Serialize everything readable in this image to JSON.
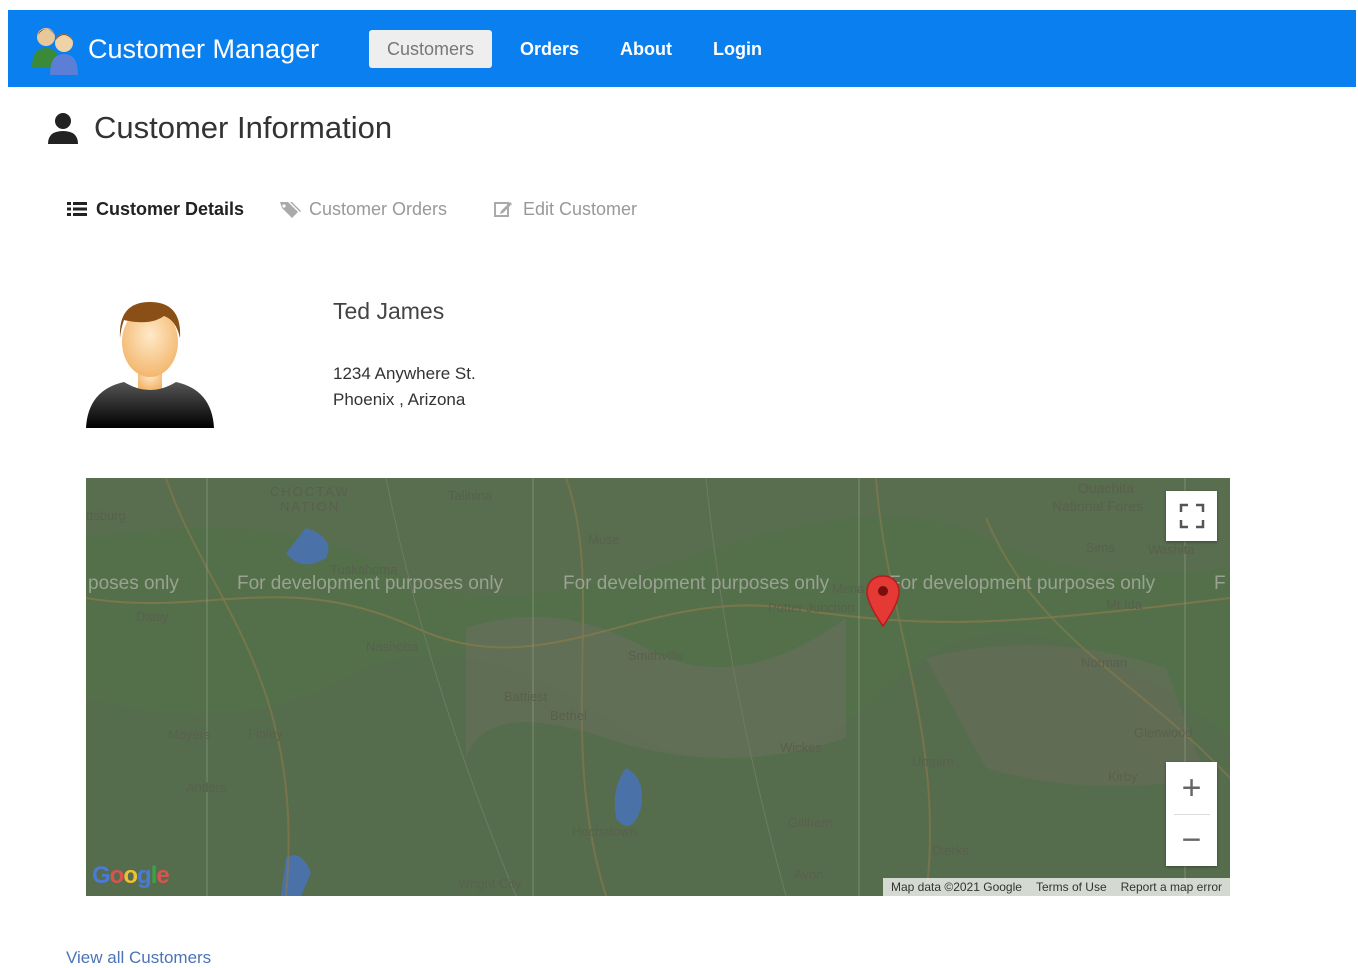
{
  "navbar": {
    "brand": "Customer Manager",
    "items": [
      {
        "label": "Customers",
        "active": true
      },
      {
        "label": "Orders",
        "active": false
      },
      {
        "label": "About",
        "active": false
      },
      {
        "label": "Login",
        "active": false
      }
    ],
    "color": "#0a7ff0"
  },
  "page": {
    "title": "Customer Information"
  },
  "tabs": [
    {
      "label": "Customer Details",
      "icon": "list-icon",
      "active": true
    },
    {
      "label": "Customer Orders",
      "icon": "tags-icon",
      "active": false
    },
    {
      "label": "Edit Customer",
      "icon": "edit-icon",
      "active": false
    }
  ],
  "customer": {
    "name": "Ted James",
    "address_line1": "1234 Anywhere St.",
    "address_line2": "Phoenix , Arizona"
  },
  "map": {
    "dev_text": "For development purposes only",
    "dev_text_partial_left": "poses only",
    "dev_text_partial_right": "F",
    "zoom_in": "+",
    "zoom_out": "−",
    "attribution": {
      "map_data": "Map data ©2021 Google",
      "terms": "Terms of Use",
      "report": "Report a map error"
    },
    "google_logo": "Google",
    "places": [
      {
        "name": "ttsburg"
      },
      {
        "name": "CHOCTAW"
      },
      {
        "name": "NATION"
      },
      {
        "name": "Talihina"
      },
      {
        "name": "Tuskahoma"
      },
      {
        "name": "Muse"
      },
      {
        "name": "Daisy"
      },
      {
        "name": "Nashoba"
      },
      {
        "name": "Smithville"
      },
      {
        "name": "Battiest"
      },
      {
        "name": "Bethel"
      },
      {
        "name": "Moyers"
      },
      {
        "name": "Finley"
      },
      {
        "name": "Antlers"
      },
      {
        "name": "Hochatown"
      },
      {
        "name": "Wright City"
      },
      {
        "name": "Potter Junction"
      },
      {
        "name": "Mena"
      },
      {
        "name": "Wickes"
      },
      {
        "name": "Gillham"
      },
      {
        "name": "Avon"
      },
      {
        "name": "Umpire"
      },
      {
        "name": "Dierks"
      },
      {
        "name": "Ouachita"
      },
      {
        "name": "National Fores"
      },
      {
        "name": "Sims"
      },
      {
        "name": "Washita"
      },
      {
        "name": "Mt Ida"
      },
      {
        "name": "Norman"
      },
      {
        "name": "Glenwood"
      },
      {
        "name": "Kirby"
      }
    ]
  },
  "footer": {
    "link": "View all Customers"
  }
}
